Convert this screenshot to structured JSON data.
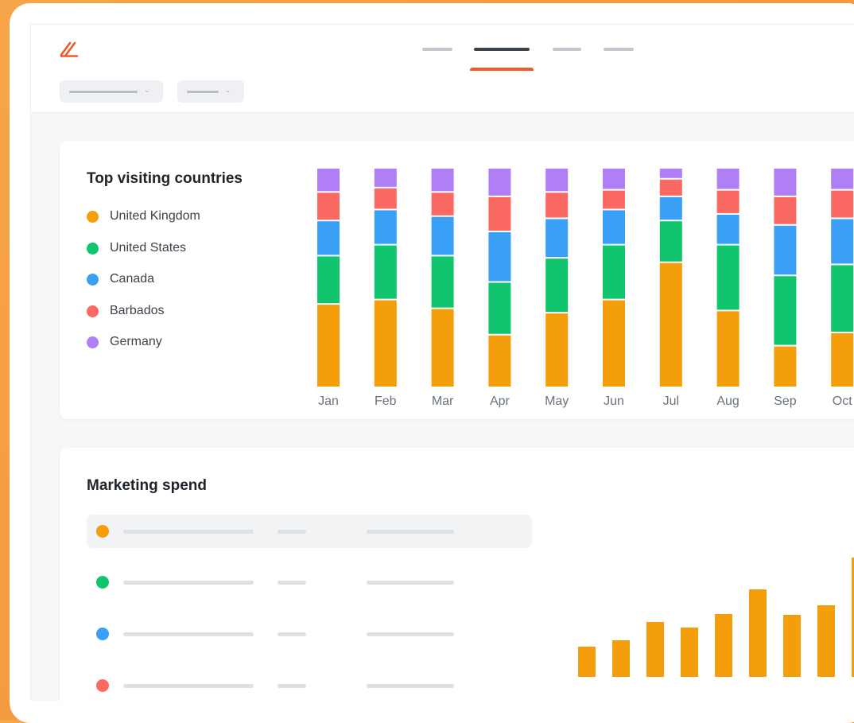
{
  "colors": {
    "united_kingdom": "#f59e0b",
    "united_states": "#10c56e",
    "canada": "#3aa0f5",
    "barbados": "#fa6a62",
    "germany": "#b07ef5",
    "accent": "#f05a28"
  },
  "header": {
    "logo_icon": "logo-slash-icon",
    "tabs_count_visible": 4,
    "active_tab_index": 1
  },
  "visiting": {
    "title": "Top visiting countries",
    "legend": [
      {
        "label": "United Kingdom",
        "color": "#f59e0b"
      },
      {
        "label": "United States",
        "color": "#10c56e"
      },
      {
        "label": "Canada",
        "color": "#3aa0f5"
      },
      {
        "label": "Barbados",
        "color": "#fa6a62"
      },
      {
        "label": "Germany",
        "color": "#b07ef5"
      }
    ]
  },
  "chart_data": [
    {
      "type": "bar",
      "stacked": true,
      "categories": [
        "Jan",
        "Feb",
        "Mar",
        "Apr",
        "May",
        "Jun",
        "Jul",
        "Aug",
        "Sep",
        "Oct"
      ],
      "series": [
        {
          "name": "United Kingdom",
          "color": "#f59e0b",
          "values": [
            38,
            40,
            36,
            24,
            34,
            40,
            57,
            35,
            19,
            25
          ]
        },
        {
          "name": "United States",
          "color": "#10c56e",
          "values": [
            22,
            25,
            24,
            24,
            25,
            25,
            19,
            30,
            32,
            31
          ]
        },
        {
          "name": "Canada",
          "color": "#3aa0f5",
          "values": [
            16,
            16,
            18,
            23,
            18,
            16,
            11,
            14,
            23,
            21
          ]
        },
        {
          "name": "Barbados",
          "color": "#fa6a62",
          "values": [
            13,
            10,
            11,
            16,
            12,
            9,
            8,
            11,
            13,
            13
          ]
        },
        {
          "name": "Germany",
          "color": "#b07ef5",
          "values": [
            11,
            9,
            11,
            13,
            11,
            10,
            5,
            10,
            13,
            10
          ]
        }
      ],
      "ylim": [
        0,
        100
      ]
    },
    {
      "type": "bar",
      "categories": [
        "",
        "",
        "",
        "",
        "",
        "",
        "",
        "",
        ""
      ],
      "values": [
        38,
        46,
        69,
        62,
        79,
        110,
        78,
        90,
        150
      ],
      "ylim": [
        0,
        150
      ]
    }
  ],
  "spend": {
    "title": "Marketing spend",
    "rows": [
      {
        "color": "#f59e0b",
        "selected": true
      },
      {
        "color": "#10c56e",
        "selected": false
      },
      {
        "color": "#3aa0f5",
        "selected": false
      },
      {
        "color": "#fa6a62",
        "selected": false
      }
    ]
  }
}
